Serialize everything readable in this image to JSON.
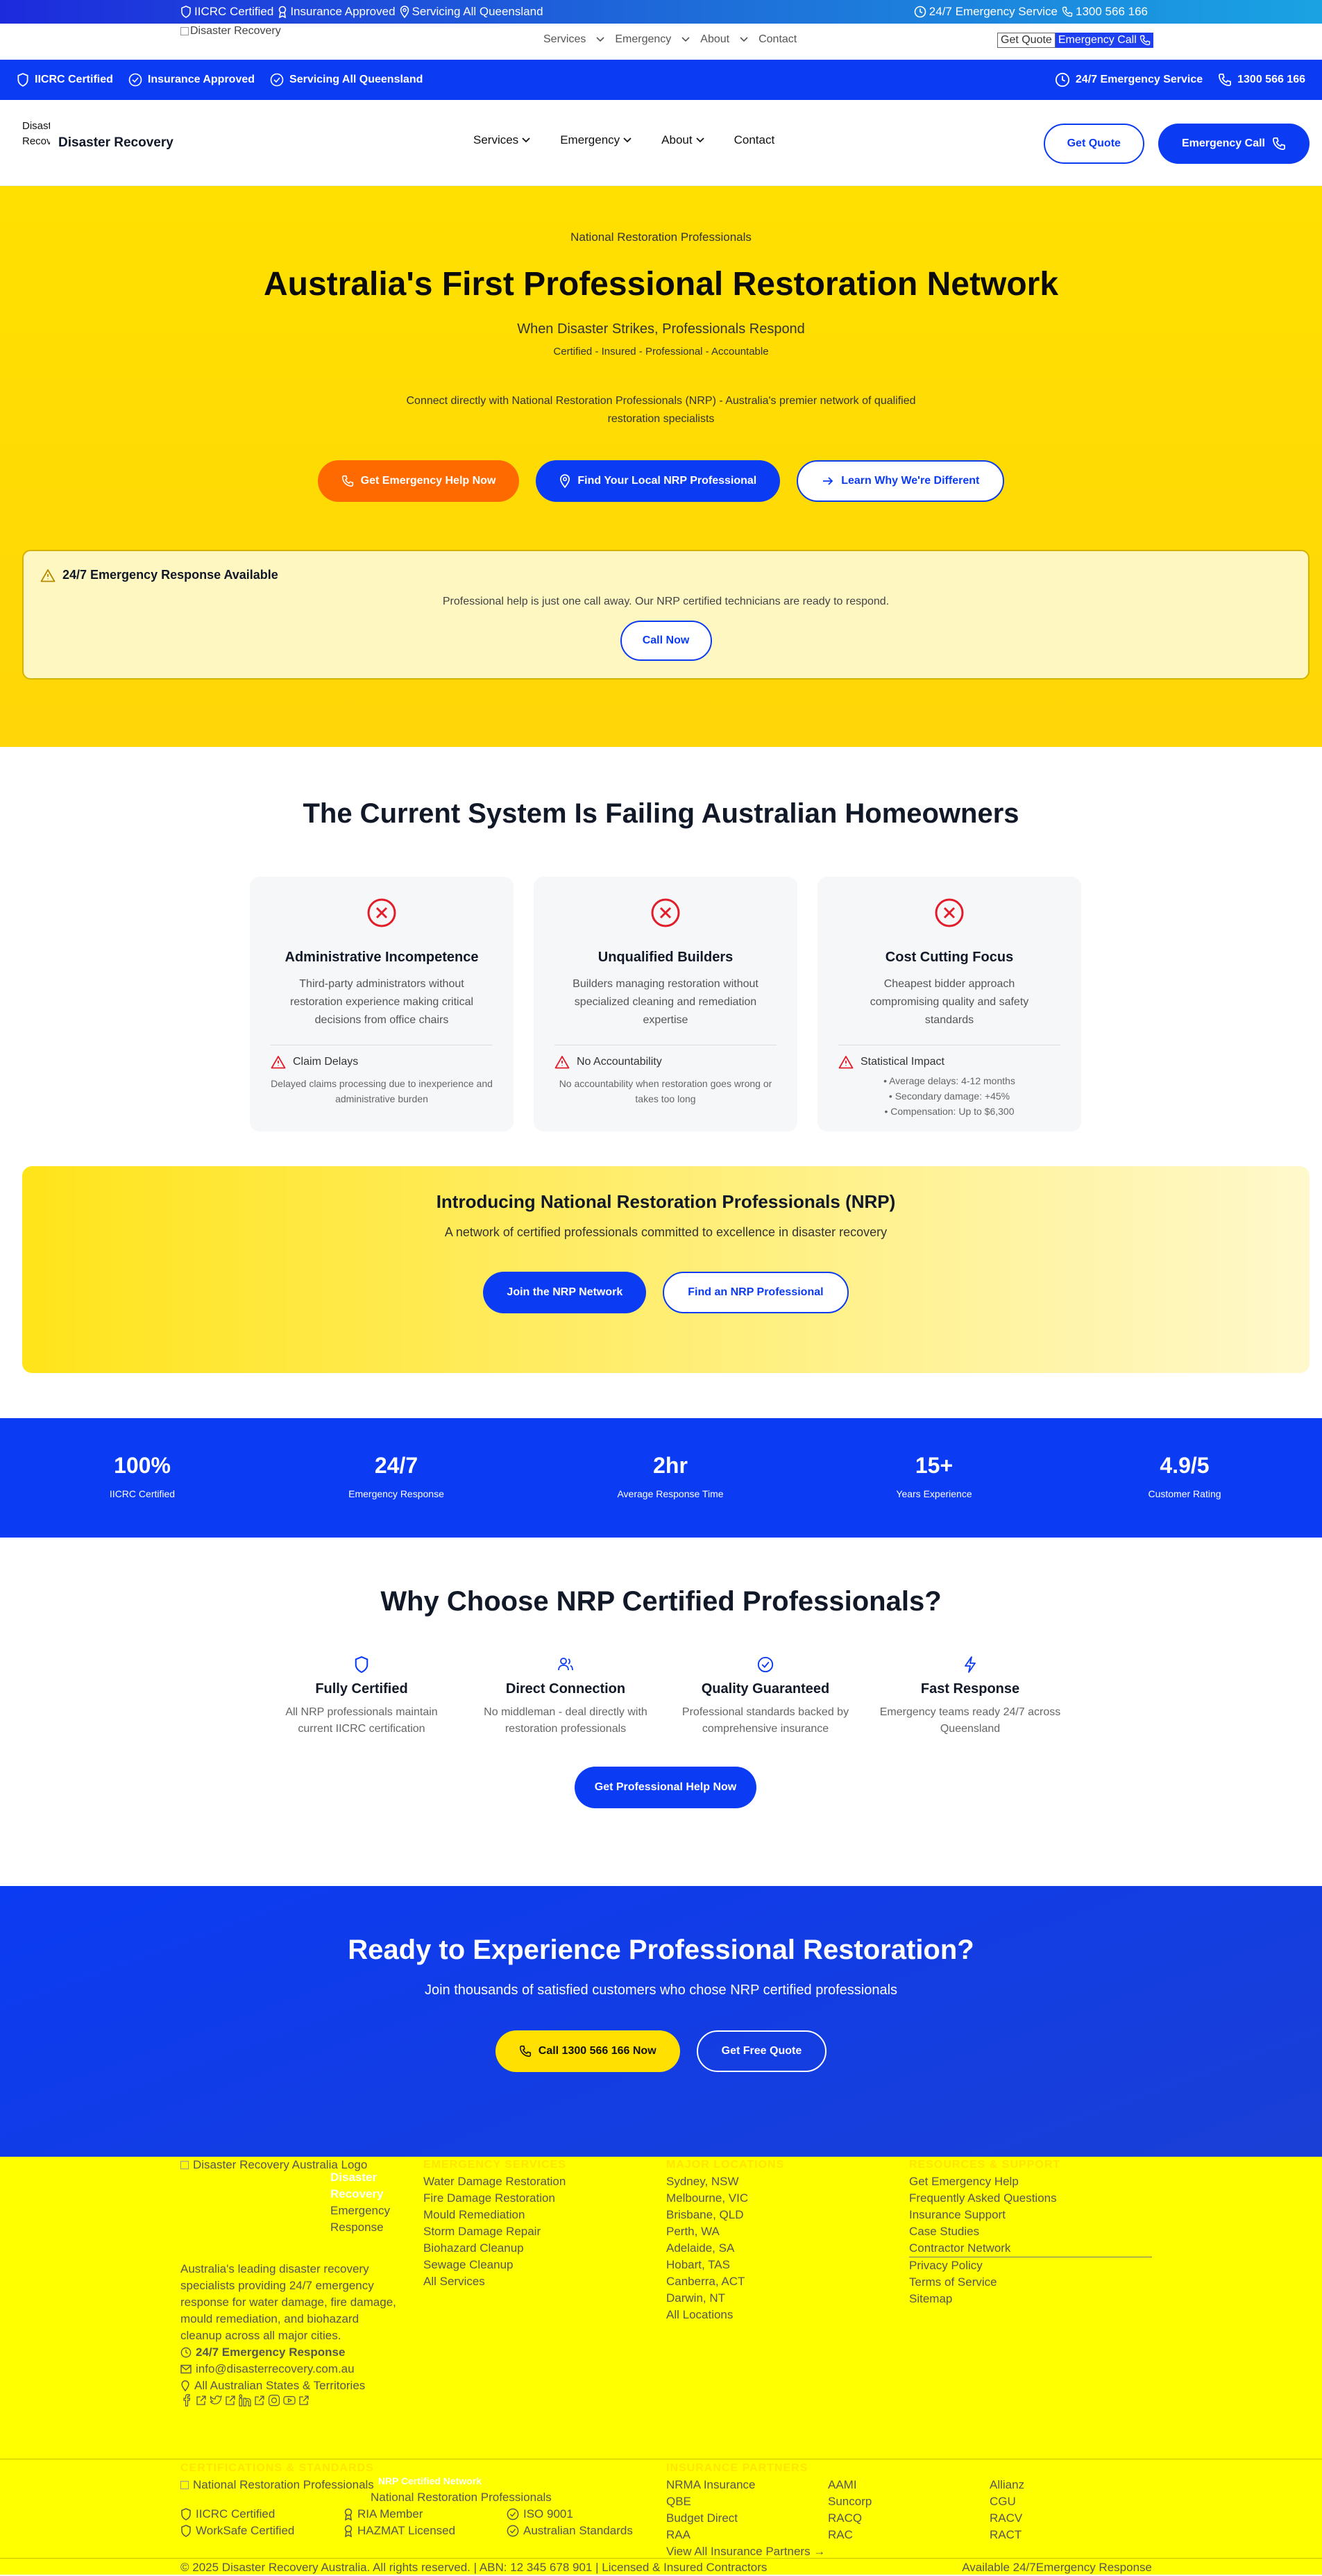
{
  "top_bar": {
    "items": [
      "IICRC Certified",
      "Insurance Approved",
      "Servicing All Queensland"
    ],
    "service": "24/7 Emergency Service",
    "phone": "1300 566 166"
  },
  "stray_nav": {
    "logo_alt": "Disaster Recovery",
    "links": [
      "Services",
      "Emergency",
      "About",
      "Contact"
    ],
    "quote": "Get Quote",
    "call": "Emergency Call"
  },
  "blue_bar": {
    "items": [
      "IICRC Certified",
      "Insurance Approved",
      "Servicing All Queensland"
    ],
    "service": "24/7 Emergency Service",
    "phone": "1300 566 166"
  },
  "header": {
    "logo_alt": "Disaster Recovery",
    "brand": "Disaster Recovery",
    "menu": [
      "Services",
      "Emergency",
      "About",
      "Contact"
    ],
    "quote": "Get Quote",
    "call": "Emergency Call"
  },
  "hero": {
    "kicker": "National Restoration Professionals",
    "title": "Australia's First Professional Restoration Network",
    "subtitle": "When Disaster Strikes, Professionals Respond",
    "tagline": "Certified - Insured - Professional - Accountable",
    "description": "Connect directly with National Restoration Professionals (NRP) - Australia's premier network of qualified restoration specialists",
    "btn_emergency": "Get Emergency Help Now",
    "btn_local": "Find Your Local NRP Professional",
    "btn_learn": "Learn Why We're Different",
    "alert_title": "24/7 Emergency Response Available",
    "alert_text": "Professional help is just one call away. Our NRP certified technicians are ready to respond.",
    "alert_btn": "Call Now"
  },
  "failing": {
    "title": "The Current System Is Failing Australian Homeowners",
    "cards": [
      {
        "title": "Administrative Incompetence",
        "desc": "Third-party administrators without restoration experience making critical decisions from office chairs",
        "stat": "Claim Delays",
        "stat_desc": "Delayed claims processing due to inexperience and administrative burden"
      },
      {
        "title": "Unqualified Builders",
        "desc": "Builders managing restoration without specialized cleaning and remediation expertise",
        "stat": "No Accountability",
        "stat_desc": "No accountability when restoration goes wrong or takes too long"
      },
      {
        "title": "Cost Cutting Focus",
        "desc": "Cheapest bidder approach compromising quality and safety standards",
        "stat": "Statistical Impact",
        "stat_list": [
          "• Average delays: 4-12 months",
          "• Secondary damage: +45%",
          "• Compensation: Up to $6,300"
        ]
      }
    ]
  },
  "intro": {
    "title": "Introducing National Restoration Professionals (NRP)",
    "text": "A network of certified professionals committed to excellence in disaster recovery",
    "join": "Join the NRP Network",
    "find": "Find an NRP Professional"
  },
  "stats": [
    {
      "value": "100%",
      "label": "IICRC Certified"
    },
    {
      "value": "24/7",
      "label": "Emergency Response"
    },
    {
      "value": "2hr",
      "label": "Average Response Time"
    },
    {
      "value": "15+",
      "label": "Years Experience"
    },
    {
      "value": "4.9/5",
      "label": "Customer Rating"
    }
  ],
  "why": {
    "title": "Why Choose NRP Certified Professionals?",
    "features": [
      {
        "title": "Fully Certified",
        "desc": "All NRP professionals maintain current IICRC certification"
      },
      {
        "title": "Direct Connection",
        "desc": "No middleman - deal directly with restoration professionals"
      },
      {
        "title": "Quality Guaranteed",
        "desc": "Professional standards backed by comprehensive insurance"
      },
      {
        "title": "Fast Response",
        "desc": "Emergency teams ready 24/7 across Queensland"
      }
    ],
    "cta": "Get Professional Help Now"
  },
  "ready": {
    "title": "Ready to Experience Professional Restoration?",
    "text": "Join thousands of satisfied customers who chose NRP certified professionals",
    "call": "Call 1300 566 166 Now",
    "quote": "Get Free Quote"
  },
  "footer": {
    "logo_alt": "Disaster Recovery Australia Logo",
    "brand_l1": "Disaster",
    "brand_l2": "Recovery",
    "brand_l3": "Emergency",
    "brand_l4": "Response",
    "about": "Australia's leading disaster recovery specialists providing 24/7 emergency response for water damage, fire damage, mould remediation, and biohazard cleanup across all major cities.",
    "emergency": "24/7 Emergency Response",
    "email": "info@disasterrecovery.com.au",
    "area": "All Australian States & Territories",
    "services_head": "EMERGENCY SERVICES",
    "services": [
      "Water Damage Restoration",
      "Fire Damage Restoration",
      "Mould Remediation",
      "Storm Damage Repair",
      "Biohazard Cleanup",
      "Sewage Cleanup",
      "All Services"
    ],
    "locations_head": "MAJOR LOCATIONS",
    "locations": [
      "Sydney, NSW",
      "Melbourne, VIC",
      "Brisbane, QLD",
      "Perth, WA",
      "Adelaide, SA",
      "Hobart, TAS",
      "Canberra, ACT",
      "Darwin, NT",
      "All Locations"
    ],
    "resources_head": "RESOURCES & SUPPORT",
    "resources": [
      "Get Emergency Help",
      "Frequently Asked Questions",
      "Insurance Support",
      "Case Studies",
      "Contractor Network",
      "Privacy Policy",
      "Terms of Service",
      "Sitemap"
    ],
    "cert_head": "CERTIFICATIONS & STANDARDS",
    "nrp_alt": "National Restoration Professionals",
    "nrp_title": "NRP Certified Network",
    "nrp_sub": "National Restoration Professionals",
    "certs": [
      "IICRC Certified",
      "RIA Member",
      "ISO 9001",
      "WorkSafe Certified",
      "HAZMAT Licensed",
      "Australian Standards"
    ],
    "partners_head": "INSURANCE PARTNERS",
    "partners": [
      "NRMA Insurance",
      "AAMI",
      "Allianz",
      "QBE",
      "Suncorp",
      "CGU",
      "Budget Direct",
      "RACQ",
      "RACV",
      "RAA",
      "RAC",
      "RACT"
    ],
    "partners_all": "View All Insurance Partners →",
    "copyright": "© 2025 Disaster Recovery Australia. All rights reserved.",
    "abn": "ABN: 12 345 678 901",
    "licensed": "Licensed & Insured Contractors",
    "available": "Available 24/7",
    "available2": "Emergency Response"
  },
  "colors": {
    "brand_blue": "#0b3bf2",
    "hero_yellow": "#ffe000",
    "orange": "#ff6a00",
    "footer_yellow": "#ffff00"
  }
}
